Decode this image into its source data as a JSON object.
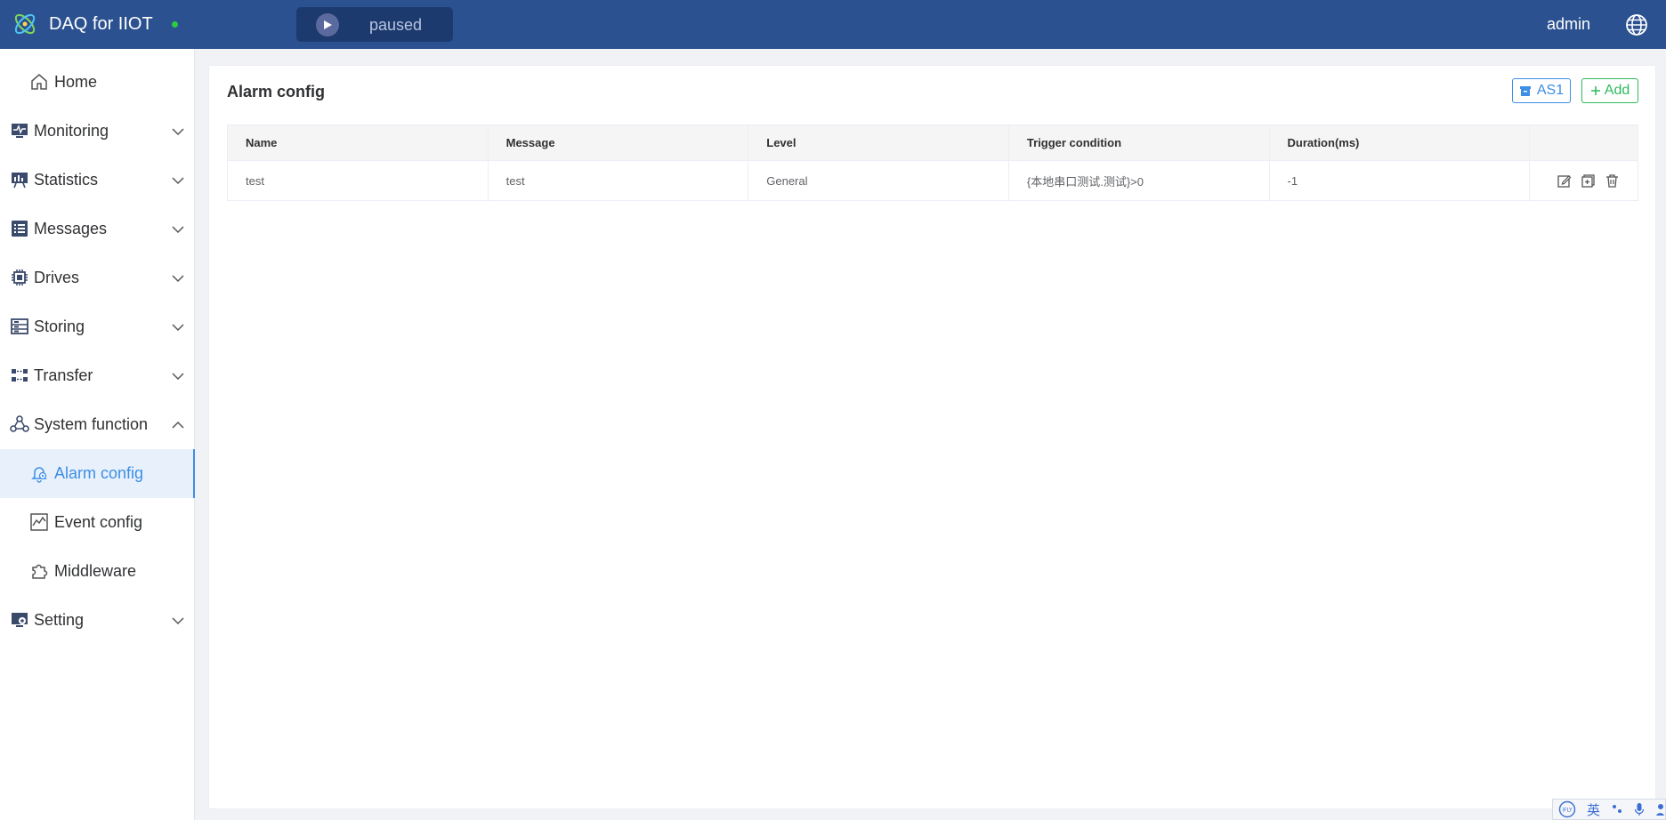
{
  "header": {
    "app_title": "DAQ for IIOT",
    "run_status": "paused",
    "user": "admin"
  },
  "sidebar": {
    "items": [
      {
        "label": "Home"
      },
      {
        "label": "Monitoring"
      },
      {
        "label": "Statistics"
      },
      {
        "label": "Messages"
      },
      {
        "label": "Drives"
      },
      {
        "label": "Storing"
      },
      {
        "label": "Transfer"
      },
      {
        "label": "System function"
      },
      {
        "label": "Alarm config"
      },
      {
        "label": "Event config"
      },
      {
        "label": "Middleware"
      },
      {
        "label": "Setting"
      }
    ]
  },
  "main": {
    "title": "Alarm config",
    "as1_label": "AS1",
    "add_label": "Add",
    "columns": [
      "Name",
      "Message",
      "Level",
      "Trigger condition",
      "Duration(ms)"
    ],
    "rows": [
      {
        "name": "test",
        "message": "test",
        "level": "General",
        "trigger": "{本地串口测试.测试}>0",
        "duration": "-1"
      }
    ]
  },
  "ime": {
    "lang": "英"
  },
  "colors": {
    "header_bg": "#2b5190",
    "accent": "#3c8ee6",
    "add_green": "#2dba5d",
    "status_green": "#2ecc40"
  }
}
